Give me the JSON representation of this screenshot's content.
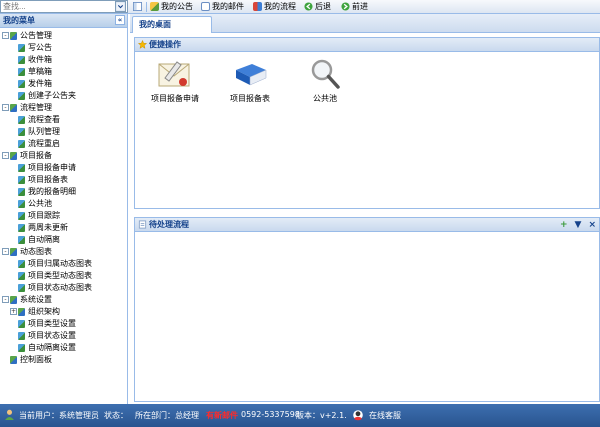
{
  "search": {
    "placeholder": "查找..."
  },
  "toolbar": {
    "my_notice": "我的公告",
    "my_mail": "我的邮件",
    "my_flow": "我的流程",
    "back": "后退",
    "forward": "前进"
  },
  "sidebar": {
    "title": "我的菜单",
    "groups": [
      {
        "label": "公告管理",
        "items": [
          "写公告",
          "收件箱",
          "草稿箱",
          "发件箱",
          "创建子公告夹"
        ]
      },
      {
        "label": "流程管理",
        "items": [
          "流程查看",
          "队列管理",
          "流程重启"
        ]
      },
      {
        "label": "项目报备",
        "items": [
          "项目报备申请",
          "项目报备表",
          "我的报备明细",
          "公共池",
          "项目跟踪",
          "两周未更新",
          "自动隔离"
        ]
      },
      {
        "label": "动态图表",
        "items": [
          "项目归属动态图表",
          "项目类型动态图表",
          "项目状态动态图表"
        ]
      },
      {
        "label": "系统设置",
        "items": [
          "组织架构",
          "项目类型设置",
          "项目状态设置",
          "自动隔离设置"
        ]
      },
      {
        "label": "控制面板",
        "items": []
      }
    ]
  },
  "tabs": {
    "desk": "我的桌面"
  },
  "quick": {
    "title": "便捷操作",
    "items": [
      "项目报备申请",
      "项目报备表",
      "公共池"
    ]
  },
  "pending": {
    "title": "待处理流程"
  },
  "status": {
    "user": "当前用户：系统管理员",
    "state": "状态：",
    "dept": "所在部门：总经理",
    "alert": "有新邮件",
    "phone": "0592-5337598",
    "version": "版本：v+2.1.",
    "support": "在线客服"
  },
  "colors": {
    "header_text": "#15428b",
    "border": "#99bbe8",
    "statusbar": "#2f5d9c",
    "alert": "#ff0000"
  }
}
